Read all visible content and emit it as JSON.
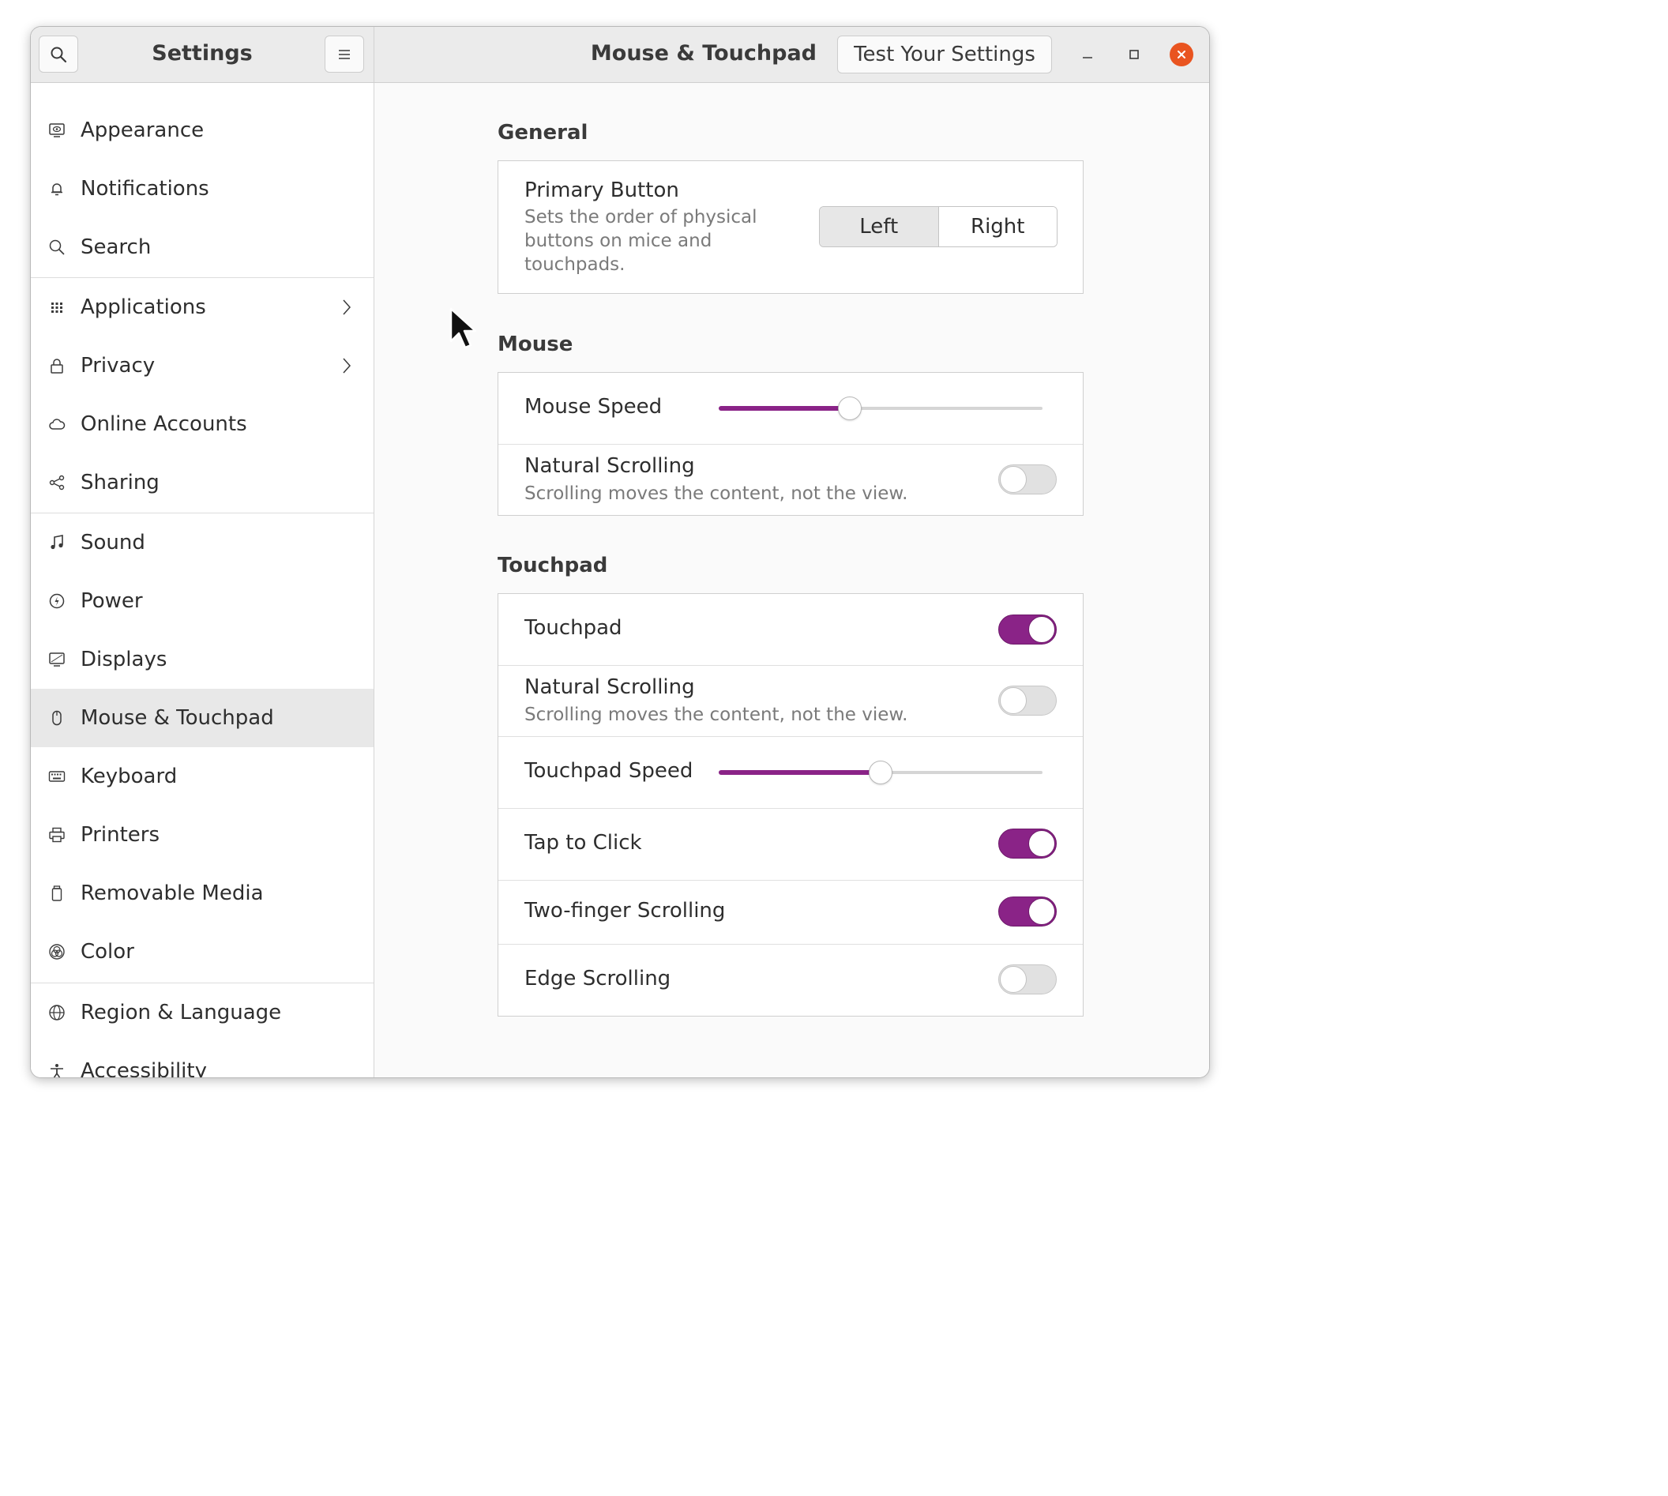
{
  "window": {
    "sidebar_title": "Settings",
    "page_title": "Mouse & Touchpad",
    "test_button": "Test Your Settings",
    "accent_color": "#8a2387",
    "close_color": "#e95420"
  },
  "sidebar": {
    "items": [
      {
        "label": "Appearance",
        "icon": "appearance-icon"
      },
      {
        "label": "Notifications",
        "icon": "bell-icon"
      },
      {
        "label": "Search",
        "icon": "search-icon"
      },
      {
        "label": "Applications",
        "icon": "apps-grid-icon",
        "has_arrow": true
      },
      {
        "label": "Privacy",
        "icon": "lock-icon",
        "has_arrow": true
      },
      {
        "label": "Online Accounts",
        "icon": "cloud-icon"
      },
      {
        "label": "Sharing",
        "icon": "share-icon"
      },
      {
        "label": "Sound",
        "icon": "music-note-icon"
      },
      {
        "label": "Power",
        "icon": "power-icon"
      },
      {
        "label": "Displays",
        "icon": "display-icon"
      },
      {
        "label": "Mouse & Touchpad",
        "icon": "mouse-icon",
        "active": true
      },
      {
        "label": "Keyboard",
        "icon": "keyboard-icon"
      },
      {
        "label": "Printers",
        "icon": "printer-icon"
      },
      {
        "label": "Removable Media",
        "icon": "removable-media-icon"
      },
      {
        "label": "Color",
        "icon": "color-icon"
      },
      {
        "label": "Region & Language",
        "icon": "globe-icon"
      },
      {
        "label": "Accessibility",
        "icon": "accessibility-icon"
      }
    ]
  },
  "general": {
    "title": "General",
    "primary_button": {
      "title": "Primary Button",
      "subtitle_lines": [
        "Sets the order of physical",
        "buttons on mice and",
        "touchpads."
      ],
      "left": "Left",
      "right": "Right",
      "selected": "Left"
    }
  },
  "mouse": {
    "title": "Mouse",
    "speed_label": "Mouse Speed",
    "speed_value": 0.405,
    "natural_scrolling": {
      "title": "Natural Scrolling",
      "subtitle": "Scrolling moves the content, not the view.",
      "on": false
    }
  },
  "touchpad": {
    "title": "Touchpad",
    "touchpad": {
      "title": "Touchpad",
      "on": true
    },
    "natural_scrolling": {
      "title": "Natural Scrolling",
      "subtitle": "Scrolling moves the content, not the view.",
      "on": false
    },
    "speed_label": "Touchpad Speed",
    "speed_value": 0.5,
    "tap_to_click": {
      "title": "Tap to Click",
      "on": true
    },
    "two_finger": {
      "title": "Two-finger Scrolling",
      "on": true
    },
    "edge": {
      "title": "Edge Scrolling",
      "on": false
    }
  }
}
